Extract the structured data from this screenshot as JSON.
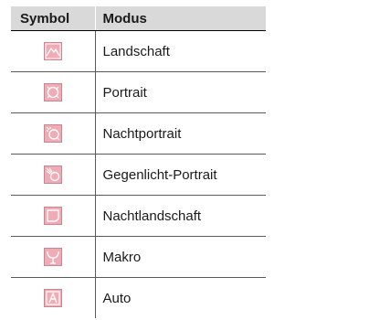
{
  "table": {
    "headers": [
      "Symbol",
      "Modus"
    ],
    "rows": [
      {
        "icon": "landscape-mode-icon",
        "mode": "Landschaft"
      },
      {
        "icon": "portrait-mode-icon",
        "mode": "Portrait"
      },
      {
        "icon": "night-portrait-mode-icon",
        "mode": "Nachtportrait"
      },
      {
        "icon": "backlight-portrait-mode-icon",
        "mode": "Gegenlicht-Portrait"
      },
      {
        "icon": "night-landscape-mode-icon",
        "mode": "Nachtlandschaft"
      },
      {
        "icon": "macro-mode-icon",
        "mode": "Makro"
      },
      {
        "icon": "auto-mode-icon",
        "mode": "Auto"
      }
    ]
  },
  "colors": {
    "icon_fill": "#f2aab4",
    "icon_border": "#c58892",
    "header_bg": "#d9d9d9"
  }
}
